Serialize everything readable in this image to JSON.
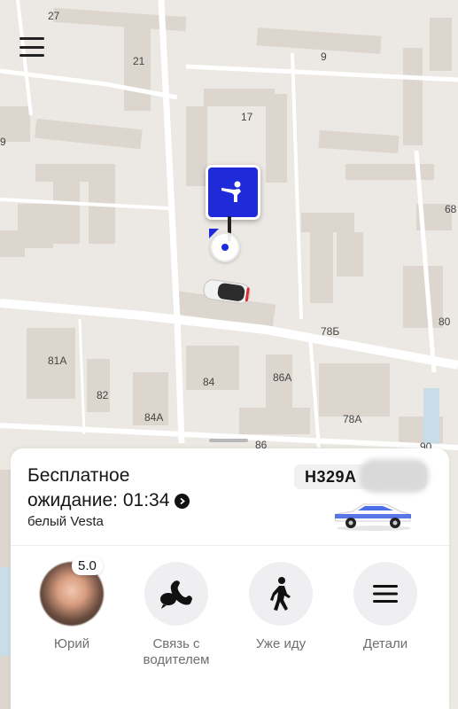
{
  "map": {
    "house_numbers": [
      {
        "id": "27",
        "text": "27"
      },
      {
        "id": "21",
        "text": "21"
      },
      {
        "id": "9",
        "text": "9"
      },
      {
        "id": "17",
        "text": "17"
      },
      {
        "id": "9b",
        "text": "9"
      },
      {
        "id": "68",
        "text": "68"
      },
      {
        "id": "80",
        "text": "80"
      },
      {
        "id": "78b",
        "text": "78Б"
      },
      {
        "id": "81a",
        "text": "81А"
      },
      {
        "id": "84",
        "text": "84"
      },
      {
        "id": "86a",
        "text": "86А"
      },
      {
        "id": "82",
        "text": "82"
      },
      {
        "id": "84a",
        "text": "84А"
      },
      {
        "id": "78a",
        "text": "78А"
      },
      {
        "id": "86",
        "text": "86"
      },
      {
        "id": "90",
        "text": "90"
      }
    ],
    "colors": {
      "land": "#ece8e3",
      "building": "#ddd6ce",
      "road": "#ffffff",
      "water": "#c8dde8",
      "pin": "#1f2bdb"
    }
  },
  "menu": {
    "icon": "hamburger-icon"
  },
  "pickup_pin": {
    "icon": "person-waving-icon"
  },
  "ride": {
    "wait_line1": "Бесплатное",
    "wait_line2": "ожидание: 01:34",
    "car_description": "белый Vesta",
    "plate": "Н329А"
  },
  "actions": [
    {
      "id": "driver",
      "label": "Юрий",
      "rating": "5.0",
      "icon": "driver-avatar"
    },
    {
      "id": "call",
      "label": "Связь с водителем",
      "icon": "phone-chat-icon"
    },
    {
      "id": "going",
      "label": "Уже иду",
      "icon": "walking-person-icon"
    },
    {
      "id": "details",
      "label": "Детали",
      "icon": "menu-lines-icon"
    }
  ]
}
